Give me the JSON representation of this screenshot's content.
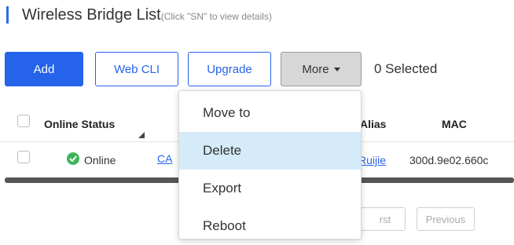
{
  "header": {
    "title": "Wireless Bridge List",
    "hint": "(Click \"SN\" to view details)"
  },
  "toolbar": {
    "add_label": "Add",
    "webcli_label": "Web CLI",
    "upgrade_label": "Upgrade",
    "more_label": "More",
    "selected_text": "0 Selected"
  },
  "table": {
    "columns": [
      "Online Status",
      "Alias",
      "MAC"
    ],
    "rows": [
      {
        "status": "Online",
        "sn_partial": "CA",
        "alias": "Ruijie",
        "mac": "300d.9e02.660c"
      }
    ]
  },
  "pagination": {
    "first_partial": "rst",
    "previous_label": "Previous"
  },
  "more_menu": {
    "items": [
      "Move to",
      "Delete",
      "Export",
      "Reboot"
    ],
    "highlighted": "Delete"
  },
  "colors": {
    "primary": "#2563eb",
    "online_green": "#3fb55b",
    "menu_hover": "#d6ebf9"
  }
}
